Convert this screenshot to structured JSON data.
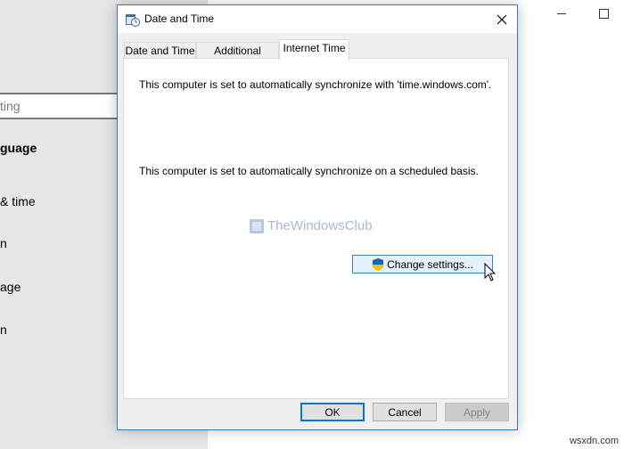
{
  "settings_window": {
    "search_placeholder": "ting",
    "items": [
      "guage",
      "& time",
      "n",
      "age",
      "n"
    ]
  },
  "dialog": {
    "title": "Date and Time",
    "tabs": [
      {
        "label": "Date and Time",
        "active": false
      },
      {
        "label": "Additional Clocks",
        "active": false
      },
      {
        "label": "Internet Time",
        "active": true
      }
    ],
    "internet_time": {
      "sync_message": "This computer is set to automatically synchronize with 'time.windows.com'.",
      "schedule_message": "This computer is set to automatically synchronize on a scheduled basis.",
      "change_settings_label": "Change settings..."
    },
    "watermark": "TheWindowsClub",
    "buttons": {
      "ok": "OK",
      "cancel": "Cancel",
      "apply": "Apply"
    }
  },
  "site_mark": "wsxdn.com",
  "colors": {
    "dialog_border": "#3b79c8",
    "default_button_border": "#0078d7",
    "button_hover_fill": "#e5f1fb"
  },
  "icons": [
    "datetime-icon",
    "close-icon",
    "shield-icon",
    "cursor-icon",
    "minimize-icon",
    "maximize-icon"
  ]
}
